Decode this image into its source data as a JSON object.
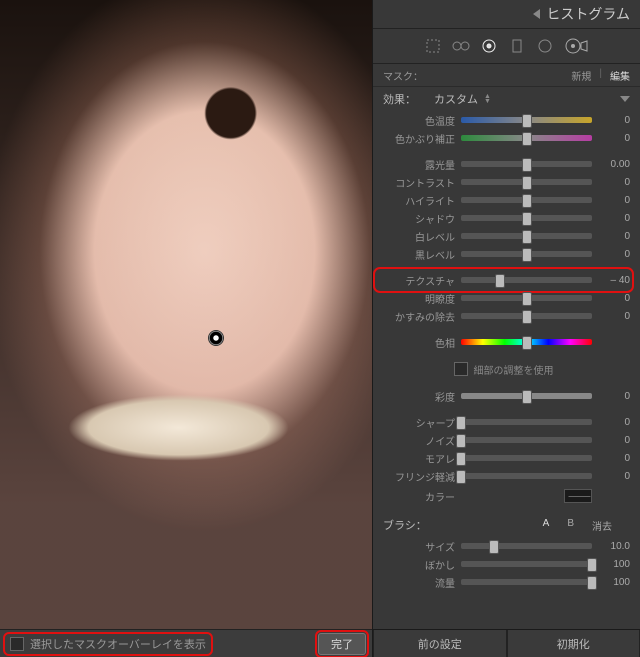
{
  "header": {
    "title": "ヒストグラム"
  },
  "mask": {
    "label": "マスク：",
    "new": "新規",
    "edit": "編集"
  },
  "effect": {
    "label": "効果：",
    "preset": "カスタム"
  },
  "sliders": [
    {
      "key": "temp",
      "label": "色温度",
      "value": "0",
      "pos": 50,
      "bar": "bar-temp"
    },
    {
      "key": "tint",
      "label": "色かぶり補正",
      "value": "0",
      "pos": 50,
      "bar": "bar-tint"
    },
    {
      "key": "exposure",
      "label": "露光量",
      "value": "0.00",
      "pos": 50,
      "bar": "bar-gray"
    },
    {
      "key": "contrast",
      "label": "コントラスト",
      "value": "0",
      "pos": 50,
      "bar": "bar-gray"
    },
    {
      "key": "highlights",
      "label": "ハイライト",
      "value": "0",
      "pos": 50,
      "bar": "bar-gray"
    },
    {
      "key": "shadows",
      "label": "シャドウ",
      "value": "0",
      "pos": 50,
      "bar": "bar-gray"
    },
    {
      "key": "whites",
      "label": "白レベル",
      "value": "0",
      "pos": 50,
      "bar": "bar-gray"
    },
    {
      "key": "blacks",
      "label": "黒レベル",
      "value": "0",
      "pos": 50,
      "bar": "bar-gray"
    },
    {
      "key": "texture",
      "label": "テクスチャ",
      "value": "– 40",
      "pos": 30,
      "bar": "bar-gray",
      "hl": true
    },
    {
      "key": "clarity",
      "label": "明瞭度",
      "value": "0",
      "pos": 50,
      "bar": "bar-gray"
    },
    {
      "key": "dehaze",
      "label": "かすみの除去",
      "value": "0",
      "pos": 50,
      "bar": "bar-gray"
    },
    {
      "key": "hue",
      "label": "色相",
      "value": "",
      "pos": 50,
      "bar": "bar-hue",
      "noval": true
    },
    {
      "key": "saturation",
      "label": "彩度",
      "value": "0",
      "pos": 50,
      "bar": "bar-sat"
    },
    {
      "key": "sharp",
      "label": "シャープ",
      "value": "0",
      "pos": 0,
      "bar": "bar-gray"
    },
    {
      "key": "noise",
      "label": "ノイズ",
      "value": "0",
      "pos": 0,
      "bar": "bar-gray"
    },
    {
      "key": "moire",
      "label": "モアレ",
      "value": "0",
      "pos": 0,
      "bar": "bar-gray"
    },
    {
      "key": "defringe",
      "label": "フリンジ軽減",
      "value": "0",
      "pos": 0,
      "bar": "bar-gray"
    }
  ],
  "fine_adjust": "細部の調整を使用",
  "color_label": "カラー",
  "brush": {
    "label": "ブラシ：",
    "a": "A",
    "b": "B",
    "erase": "消去",
    "size_label": "サイズ",
    "size_value": "10.0",
    "feather_label": "ぼかし",
    "feather_value": "100",
    "flow_label": "流量",
    "flow_value": "100"
  },
  "footer": {
    "overlay_label": "選択したマスクオーバーレイを表示",
    "done": "完了",
    "prev": "前の設定",
    "reset": "初期化"
  }
}
